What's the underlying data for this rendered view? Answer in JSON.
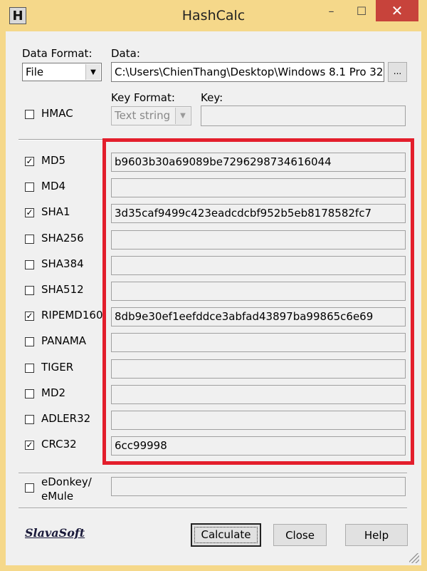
{
  "window": {
    "title": "HashCalc",
    "icon_letter": "H",
    "min": "–",
    "max": "☐",
    "close": "✕"
  },
  "data_format": {
    "label": "Data Format:",
    "value": "File"
  },
  "data": {
    "label": "Data:",
    "value": "C:\\Users\\ChienThang\\Desktop\\Windows 8.1 Pro 32",
    "browse_label": "..."
  },
  "hmac": {
    "label": "HMAC",
    "checked": false
  },
  "key_format": {
    "label": "Key Format:",
    "value": "Text string"
  },
  "key": {
    "label": "Key:",
    "value": ""
  },
  "hashes": [
    {
      "name": "MD5",
      "checked": true,
      "value": "b9603b30a69089be7296298734616044"
    },
    {
      "name": "MD4",
      "checked": false,
      "value": ""
    },
    {
      "name": "SHA1",
      "checked": true,
      "value": "3d35caf9499c423eadcdcbf952b5eb8178582fc7"
    },
    {
      "name": "SHA256",
      "checked": false,
      "value": ""
    },
    {
      "name": "SHA384",
      "checked": false,
      "value": ""
    },
    {
      "name": "SHA512",
      "checked": false,
      "value": ""
    },
    {
      "name": "RIPEMD160",
      "checked": true,
      "value": "8db9e30ef1eefddce3abfad43897ba99865c6e69"
    },
    {
      "name": "PANAMA",
      "checked": false,
      "value": ""
    },
    {
      "name": "TIGER",
      "checked": false,
      "value": ""
    },
    {
      "name": "MD2",
      "checked": false,
      "value": ""
    },
    {
      "name": "ADLER32",
      "checked": false,
      "value": ""
    },
    {
      "name": "CRC32",
      "checked": true,
      "value": "6cc99998"
    }
  ],
  "edonkey": {
    "label_line1": "eDonkey/",
    "label_line2": "eMule",
    "checked": false,
    "value": ""
  },
  "logo": "SlavaSoft",
  "buttons": {
    "calculate": "Calculate",
    "close": "Close",
    "help": "Help"
  },
  "highlight_color": "#e31e2c"
}
